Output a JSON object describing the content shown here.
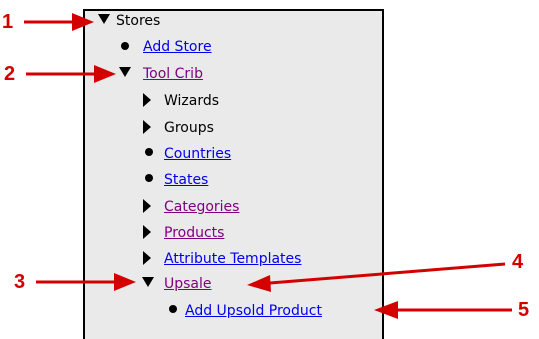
{
  "tree": {
    "stores": "Stores",
    "add_store": "Add Store",
    "tool_crib": "Tool Crib",
    "wizards": "Wizards",
    "groups": "Groups",
    "countries": "Countries",
    "states": "States",
    "categories": "Categories",
    "products": "Products",
    "attribute_templates": "Attribute Templates",
    "upsale": "Upsale",
    "add_upsold_product": "Add Upsold Product"
  },
  "callouts": [
    "1",
    "2",
    "3",
    "4",
    "5"
  ],
  "colors": {
    "panel_bg": "#eaeaea",
    "link": "#0000ee",
    "visited_link": "#800080",
    "callout": "#d40000"
  }
}
